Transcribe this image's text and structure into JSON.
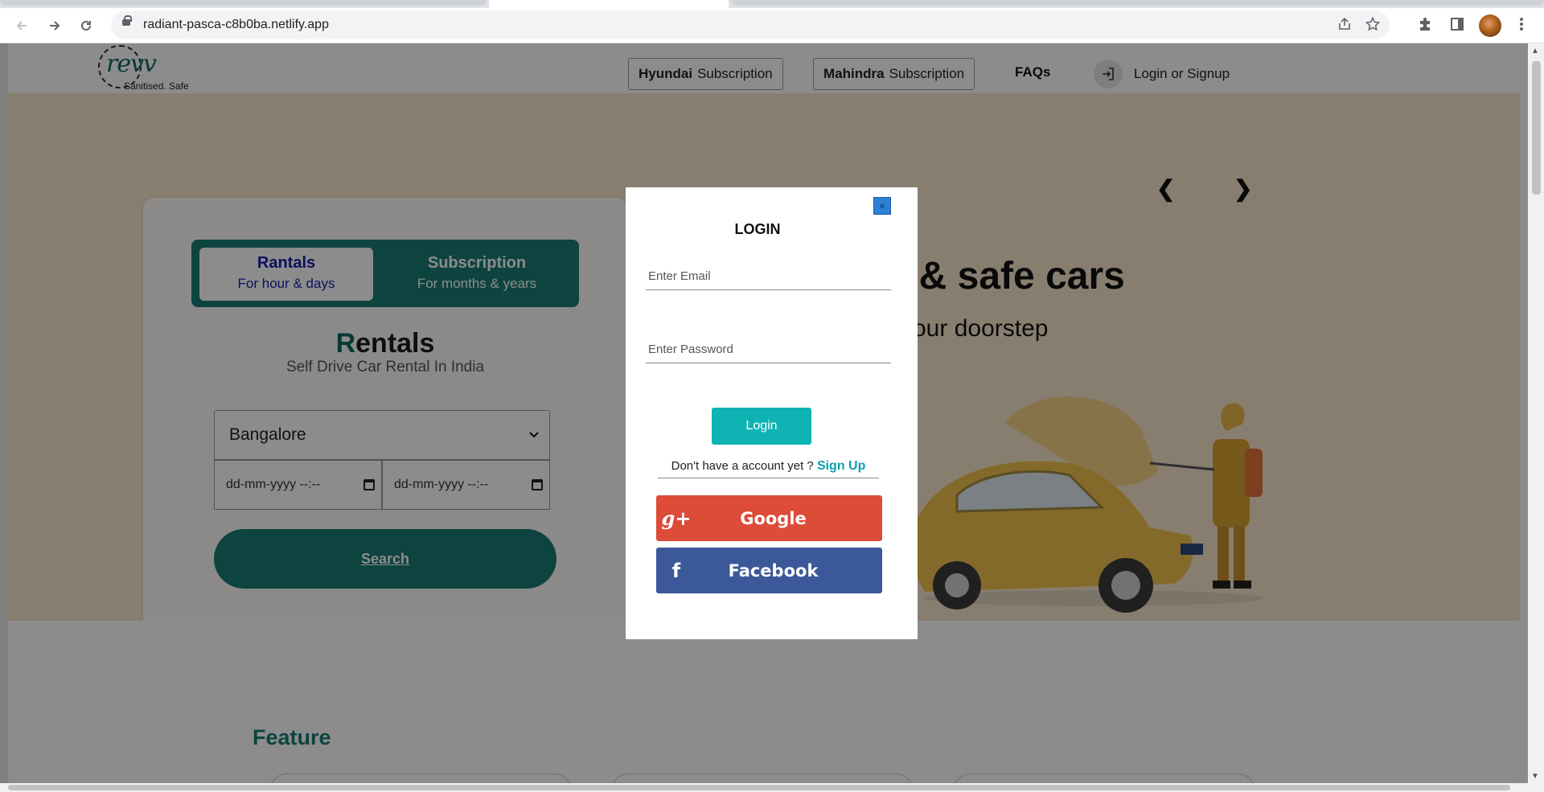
{
  "browser": {
    "url": "radiant-pasca-c8b0ba.netlify.app",
    "nav": {
      "back_icon": "arrow-left-icon",
      "forward_icon": "arrow-right-icon",
      "reload_icon": "reload-icon"
    }
  },
  "header": {
    "logo_text": "revv",
    "logo_tagline": "Sanitised. Safe",
    "hyundai_brand": "Hyundai",
    "hyundai_label": "Subscription",
    "mahindra_brand": "Mahindra",
    "mahindra_label": "Subscription",
    "faqs": "FAQs",
    "login_label": "Login or Signup"
  },
  "hero": {
    "prev_arrow": "❮",
    "next_arrow": "❯",
    "title": "d & safe cars",
    "subtitle": "our doorstep"
  },
  "booking": {
    "tab_rentals_title": "Rantals",
    "tab_rentals_sub": "For hour & days",
    "tab_subscription_title": "Subscription",
    "tab_subscription_sub": "For months & years",
    "heading_first": "R",
    "heading_rest": "entals",
    "subheading": "Self Drive Car Rental In India",
    "city": "Bangalore",
    "start_placeholder": "dd-mm-yyyy --:--",
    "end_placeholder": "dd-mm-yyyy --:--",
    "search_label": "Search"
  },
  "feature": {
    "title": "Feature"
  },
  "login_modal": {
    "close_label": "×",
    "title": "LOGIN",
    "email_placeholder": "Enter Email",
    "password_placeholder": "Enter Password",
    "login_button": "Login",
    "no_account_text": "Don't have a account yet ?",
    "signup_link": "Sign Up",
    "google_label": "Google",
    "google_icon": "g+",
    "facebook_label": "Facebook",
    "facebook_icon": "f"
  },
  "colors": {
    "brand_teal": "#1a7d74",
    "login_button": "#0fb3b3",
    "google": "#dd4b39",
    "facebook": "#3b5998",
    "hero_bg": "#f8e6cc"
  }
}
